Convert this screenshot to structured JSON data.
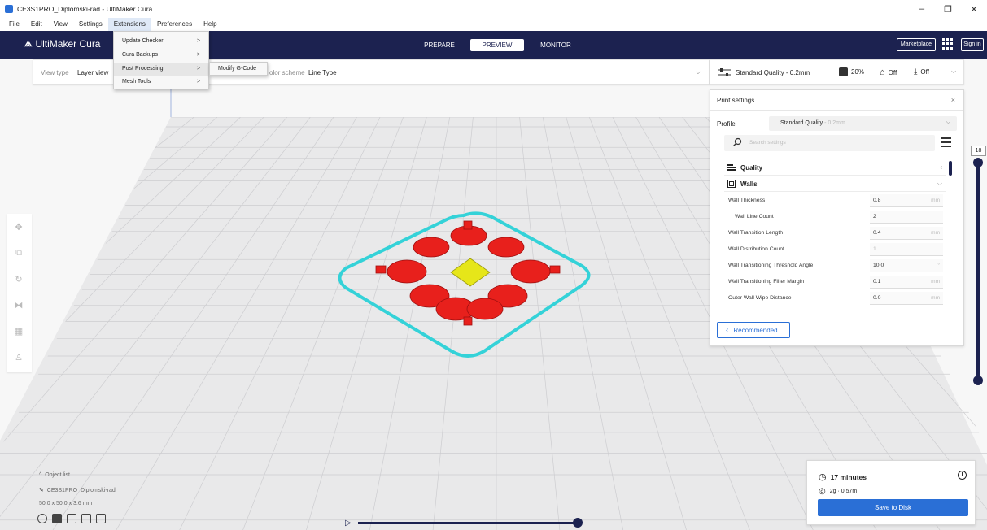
{
  "window": {
    "title": "CE3S1PRO_Diplomski-rad - UltiMaker Cura",
    "minimize": "–",
    "maximize": "❐",
    "close": "✕"
  },
  "menubar": [
    "File",
    "Edit",
    "View",
    "Settings",
    "Extensions",
    "Preferences",
    "Help"
  ],
  "extensions_menu": {
    "items": [
      {
        "label": "Update Checker",
        "arrow": ">"
      },
      {
        "label": "Cura Backups",
        "arrow": ">"
      },
      {
        "label": "Post Processing",
        "arrow": ">"
      },
      {
        "label": "Mesh Tools",
        "arrow": ">"
      }
    ],
    "submenu_item": "Modify G-Code"
  },
  "header": {
    "logo": "UltiMaker Cura",
    "tabs": [
      "PREPARE",
      "PREVIEW",
      "MONITOR"
    ],
    "active_tab": "PREVIEW",
    "marketplace": "Marketplace",
    "signin": "Sign in"
  },
  "view_bar": {
    "view_type_label": "View type",
    "view_type_value": "Layer view",
    "color_scheme_label": "olor scheme",
    "color_scheme_value": "Line Type"
  },
  "print_bar": {
    "quality": "Standard Quality - 0.2mm",
    "infill": "20%",
    "support": "Off",
    "adhesion": "Off"
  },
  "print_settings": {
    "title": "Print settings",
    "profile_label": "Profile",
    "profile_value": "Standard Quality",
    "profile_suffix": "- 0.2mm",
    "search_placeholder": "Search settings",
    "categories": [
      {
        "label": "Quality"
      },
      {
        "label": "Walls"
      }
    ],
    "settings": [
      {
        "name": "Wall Thickness",
        "value": "0.8",
        "unit": "mm"
      },
      {
        "name": "Wall Line Count",
        "value": "2",
        "unit": ""
      },
      {
        "name": "Wall Transition Length",
        "value": "0.4",
        "unit": "mm"
      },
      {
        "name": "Wall Distribution Count",
        "value": "1",
        "unit": ""
      },
      {
        "name": "Wall Transitioning Threshold Angle",
        "value": "10.0",
        "unit": "°"
      },
      {
        "name": "Wall Transitioning Filter Margin",
        "value": "0.1",
        "unit": "mm"
      },
      {
        "name": "Outer Wall Wipe Distance",
        "value": "0.0",
        "unit": "mm"
      }
    ],
    "recommended_button": "Recommended"
  },
  "layer_slider": {
    "current_layer": "18"
  },
  "object_list": {
    "header": "Object list",
    "object_name": "CE3S1PRO_Diplomski-rad",
    "dimensions": "50.0 x 50.0 x 3.6 mm"
  },
  "action_panel": {
    "print_time": "17 minutes",
    "material": "2g · 0.57m",
    "save_button": "Save to Disk"
  },
  "colors": {
    "header_bg": "#1c2250",
    "accent": "#2a6fd6",
    "model_red": "#e8201c",
    "skirt_cyan": "#34d2d8",
    "infill_yellow": "#e6e619"
  }
}
